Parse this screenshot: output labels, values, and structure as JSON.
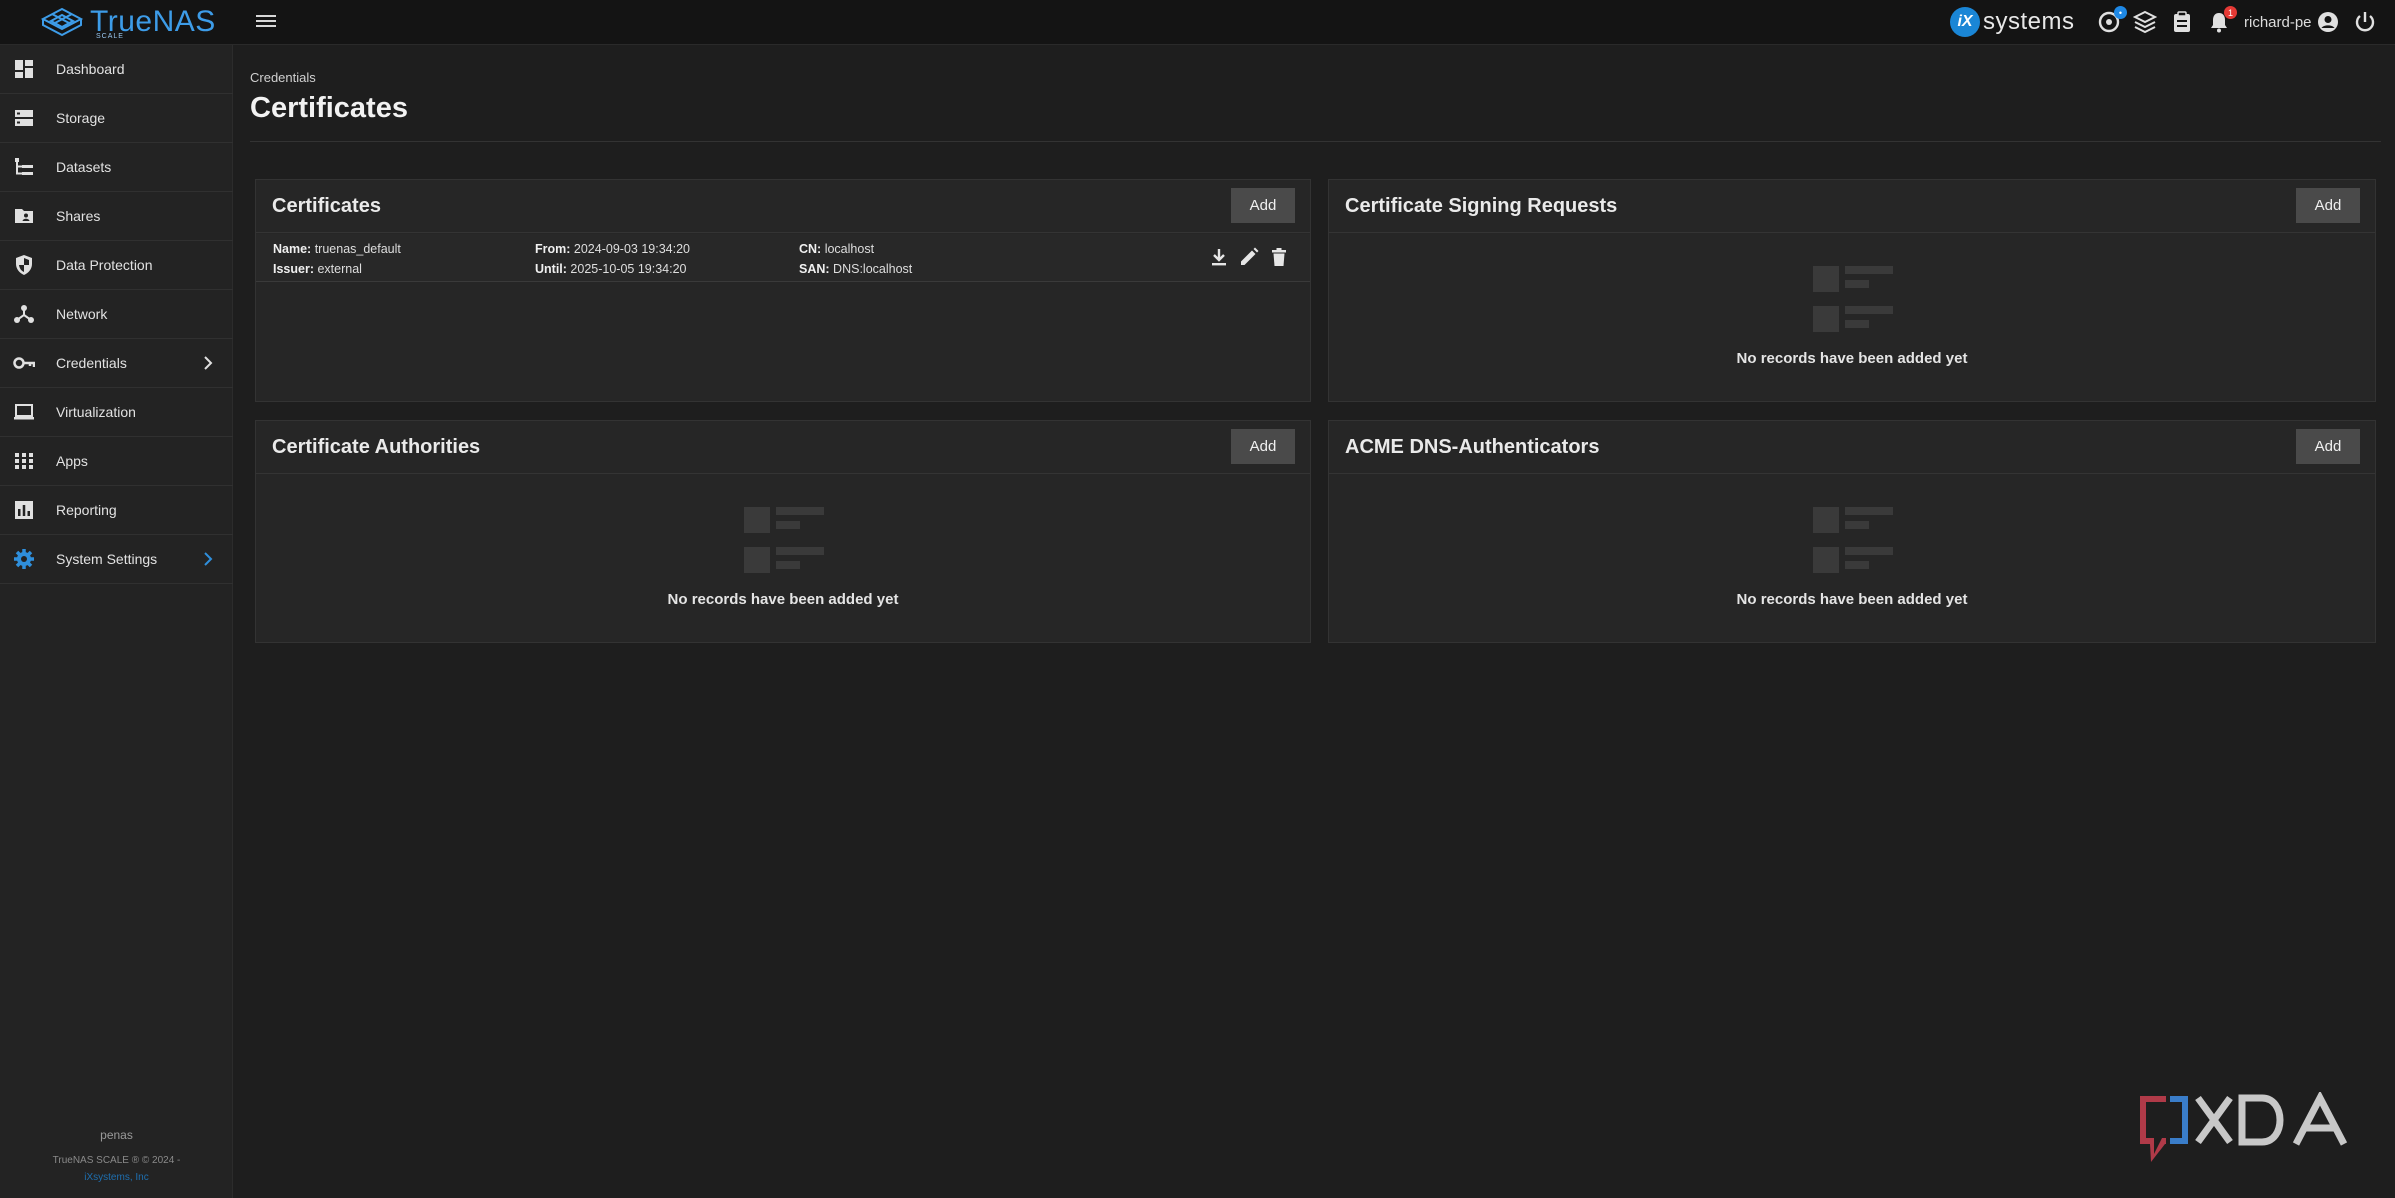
{
  "brand": {
    "name": "TrueNAS",
    "edition": "SCALE"
  },
  "header": {
    "vendor": "systems",
    "vendor_mark": "iX",
    "notifications_count": "1",
    "username": "richard-pe"
  },
  "sidebar": {
    "items": [
      {
        "label": "Dashboard"
      },
      {
        "label": "Storage"
      },
      {
        "label": "Datasets"
      },
      {
        "label": "Shares"
      },
      {
        "label": "Data Protection"
      },
      {
        "label": "Network"
      },
      {
        "label": "Credentials"
      },
      {
        "label": "Virtualization"
      },
      {
        "label": "Apps"
      },
      {
        "label": "Reporting"
      },
      {
        "label": "System Settings"
      }
    ],
    "hostname": "penas",
    "copyright": "TrueNAS SCALE ® © 2024 -",
    "company": "iXsystems, Inc"
  },
  "page": {
    "breadcrumb": "Credentials",
    "title": "Certificates"
  },
  "cards": {
    "certificates": {
      "title": "Certificates",
      "add_label": "Add",
      "rows": [
        {
          "name_label": "Name:",
          "name": "truenas_default",
          "issuer_label": "Issuer:",
          "issuer": "external",
          "from_label": "From:",
          "from": "2024-09-03 19:34:20",
          "until_label": "Until:",
          "until": "2025-10-05 19:34:20",
          "cn_label": "CN:",
          "cn": "localhost",
          "san_label": "SAN:",
          "san": "DNS:localhost"
        }
      ]
    },
    "csr": {
      "title": "Certificate Signing Requests",
      "add_label": "Add",
      "empty": "No records have been added yet"
    },
    "authorities": {
      "title": "Certificate Authorities",
      "add_label": "Add",
      "empty": "No records have been added yet"
    },
    "acme": {
      "title": "ACME DNS-Authenticators",
      "add_label": "Add",
      "empty": "No records have been added yet"
    }
  },
  "watermark": "XDA",
  "colors": {
    "accent": "#3d9ce8",
    "background": "#1e1e1e",
    "card": "#262626",
    "button": "#4a4a4a"
  }
}
